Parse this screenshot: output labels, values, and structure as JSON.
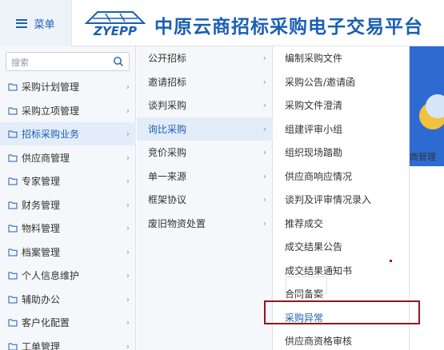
{
  "header": {
    "menu_label": "菜单",
    "logo_text": "ZYEPP",
    "title": "中原云商招标采购电子交易平台"
  },
  "search": {
    "placeholder": "搜索"
  },
  "level1": [
    {
      "label": "采购计划管理",
      "active": false
    },
    {
      "label": "采购立项管理",
      "active": false
    },
    {
      "label": "招标采购业务",
      "active": true
    },
    {
      "label": "供应商管理",
      "active": false
    },
    {
      "label": "专家管理",
      "active": false
    },
    {
      "label": "财务管理",
      "active": false
    },
    {
      "label": "物料管理",
      "active": false
    },
    {
      "label": "档案管理",
      "active": false
    },
    {
      "label": "个人信息维护",
      "active": false
    },
    {
      "label": "辅助办公",
      "active": false
    },
    {
      "label": "客户化配置",
      "active": false
    },
    {
      "label": "工单管理",
      "active": false
    }
  ],
  "level2": [
    {
      "label": "公开招标",
      "active": false
    },
    {
      "label": "邀请招标",
      "active": false
    },
    {
      "label": "谈判采购",
      "active": false
    },
    {
      "label": "询比采购",
      "active": true
    },
    {
      "label": "竞价采购",
      "active": false
    },
    {
      "label": "单一来源",
      "active": false
    },
    {
      "label": "框架协议",
      "active": false
    },
    {
      "label": "废旧物资处置",
      "active": false
    }
  ],
  "level3": [
    {
      "label": "编制采购文件",
      "highlight": false
    },
    {
      "label": "采购公告/邀请函",
      "highlight": false
    },
    {
      "label": "采购文件澄清",
      "highlight": false
    },
    {
      "label": "组建评审小组",
      "highlight": false
    },
    {
      "label": "组织现场踏勘",
      "highlight": false
    },
    {
      "label": "供应商响应情况",
      "highlight": false
    },
    {
      "label": "谈判及评审情况录入",
      "highlight": false
    },
    {
      "label": "推荐成交",
      "highlight": false
    },
    {
      "label": "成交结果公告",
      "highlight": false
    },
    {
      "label": "成交结果通知书",
      "highlight": false
    },
    {
      "label": "合同备案",
      "highlight": false
    },
    {
      "label": "采购异常",
      "highlight": true
    },
    {
      "label": "供应商资格审核",
      "highlight": false
    }
  ],
  "background": {
    "tile_label": "商管理"
  },
  "colors": {
    "brand": "#1a5fb4",
    "highlight_border": "#8b1a1a",
    "active_bg": "#e3edf9"
  },
  "icons": {
    "chevron": "›"
  }
}
